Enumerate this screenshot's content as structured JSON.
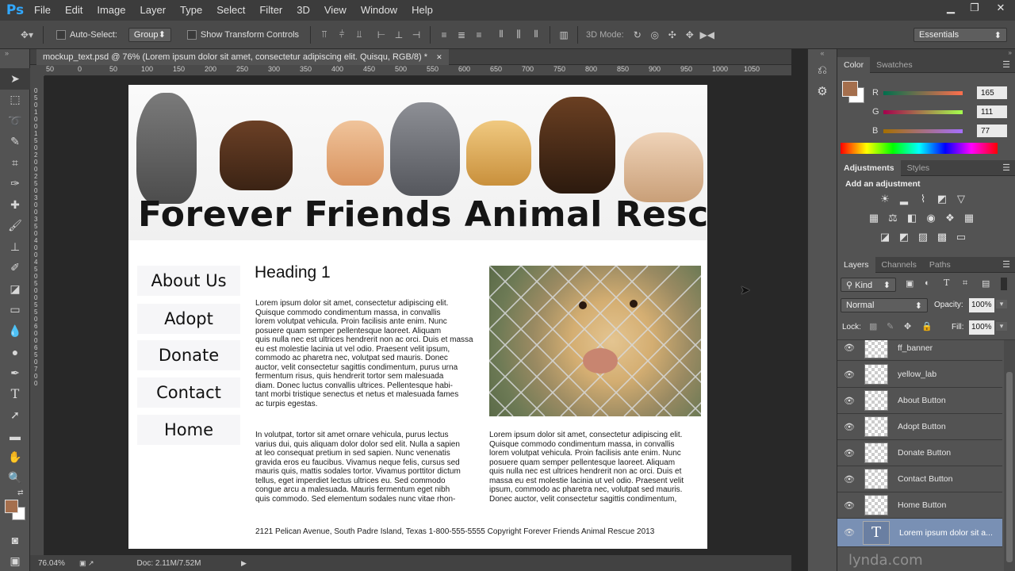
{
  "app": {
    "logo": "Ps"
  },
  "menu": [
    "File",
    "Edit",
    "Image",
    "Layer",
    "Type",
    "Select",
    "Filter",
    "3D",
    "View",
    "Window",
    "Help"
  ],
  "window_controls": {
    "minimize": "▁",
    "restore": "❐",
    "close": "✕"
  },
  "options": {
    "auto_select_label": "Auto-Select:",
    "auto_select_value": "Group",
    "transform_label": "Show Transform Controls",
    "mode3d_label": "3D Mode:",
    "workspace": "Essentials"
  },
  "document": {
    "tab_title": "mockup_text.psd @ 76% (Lorem ipsum dolor sit amet, consectetur adipiscing elit. Quisqu, RGB/8) *",
    "close": "✕"
  },
  "ruler_h": [
    "50",
    "0",
    "50",
    "100",
    "150",
    "200",
    "250",
    "300",
    "350",
    "400",
    "450",
    "500",
    "550",
    "600",
    "650",
    "700",
    "750",
    "800",
    "850",
    "900",
    "950",
    "1000",
    "1050"
  ],
  "ruler_v": [
    "0",
    "5",
    "0",
    "1",
    "0",
    "0",
    "1",
    "5",
    "0",
    "2",
    "0",
    "0",
    "2",
    "5",
    "0",
    "3",
    "0",
    "0",
    "3",
    "5",
    "0",
    "4",
    "0",
    "0",
    "4",
    "5",
    "0",
    "5",
    "0",
    "0",
    "5",
    "5",
    "0",
    "6",
    "0",
    "0",
    "6",
    "5",
    "0",
    "7",
    "0",
    "0"
  ],
  "status": {
    "zoom": "76.04%",
    "doc": "Doc: 2.11M/7.52M"
  },
  "mockup": {
    "banner_title": "Forever Friends Animal Rescue",
    "nav": [
      "About Us",
      "Adopt",
      "Donate",
      "Contact",
      "Home"
    ],
    "heading": "Heading 1",
    "para1": [
      "Lorem ipsum dolor sit amet, consectetur adipiscing elit.",
      "Quisque commodo condimentum massa, in convallis",
      "lorem volutpat vehicula. Proin facilisis ante enim. Nunc",
      "posuere quam semper pellentesque laoreet. Aliquam",
      "quis nulla nec est ultrices hendrerit non ac orci. Duis et massa",
      "eu est molestie lacinia ut vel odio. Praesent velit ipsum,",
      "commodo ac pharetra nec, volutpat sed mauris. Donec",
      "auctor, velit consectetur sagittis condimentum, purus urna",
      "fermentum risus, quis hendrerit tortor sem malesuada",
      "diam. Donec luctus convallis ultrices. Pellentesque habi-",
      "tant morbi tristique senectus et netus et malesuada fames",
      "ac turpis egestas."
    ],
    "para2": [
      "In volutpat, tortor sit amet ornare vehicula, purus lectus",
      "varius dui, quis aliquam dolor dolor sed elit. Nulla a sapien",
      "at leo consequat pretium in sed sapien. Nunc venenatis",
      "gravida eros eu faucibus. Vivamus neque felis, cursus sed",
      "mauris quis, mattis sodales tortor. Vivamus porttitor dictum",
      "tellus, eget imperdiet lectus ultrices eu. Sed commodo",
      "congue arcu a malesuada. Mauris fermentum eget nibh",
      "quis commodo. Sed elementum sodales nunc vitae rhon-"
    ],
    "para3": [
      "Lorem ipsum dolor sit amet, consectetur adipiscing elit.",
      "Quisque commodo condimentum massa, in convallis",
      "lorem volutpat vehicula. Proin facilisis ante enim. Nunc",
      "posuere quam semper pellentesque laoreet. Aliquam",
      "quis nulla nec est ultrices hendrerit non ac orci. Duis et",
      "massa eu est molestie lacinia ut vel odio. Praesent velit",
      "ipsum, commodo ac pharetra nec, volutpat sed mauris.",
      "Donec auctor, velit consectetur sagittis condimentum,"
    ],
    "footer": "2121 Pelican Avenue, South Padre Island, Texas 1-800-555-5555   Copyright Forever Friends Animal Rescue 2013"
  },
  "color_panel": {
    "tabs": [
      "Color",
      "Swatches"
    ],
    "r_label": "R",
    "r": "165",
    "g_label": "G",
    "g": "111",
    "b_label": "B",
    "b": "77",
    "foreground": "#a56f4d"
  },
  "adjustments": {
    "tabs": [
      "Adjustments",
      "Styles"
    ],
    "add_label": "Add an adjustment"
  },
  "layers_panel": {
    "tabs": [
      "Layers",
      "Channels",
      "Paths"
    ],
    "kind": "Kind",
    "blend": "Normal",
    "opacity_label": "Opacity:",
    "opacity": "100%",
    "lock_label": "Lock:",
    "fill_label": "Fill:",
    "fill": "100%",
    "layers": [
      "ff_banner",
      "yellow_lab",
      "About Button",
      "Adopt Button",
      "Donate Button",
      "Contact Button",
      "Home Button",
      "Lorem ipsum dolor sit a..."
    ]
  },
  "watermark": "lynda.com"
}
